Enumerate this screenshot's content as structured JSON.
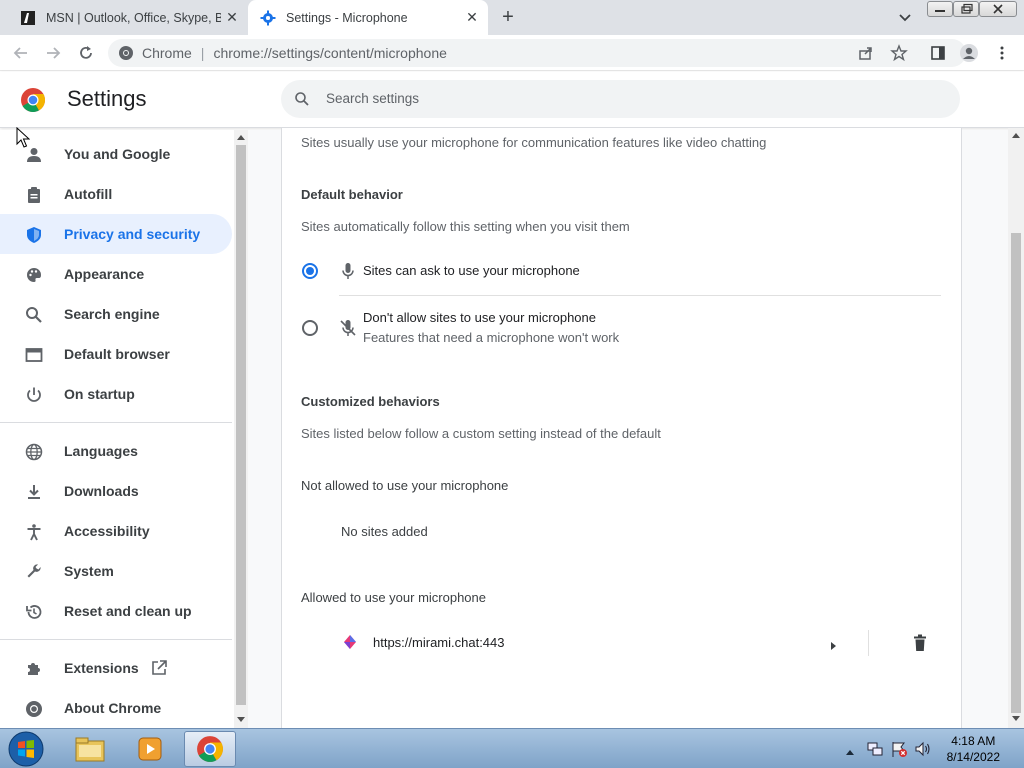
{
  "tabs": [
    {
      "title": "MSN | Outlook, Office, Skype, Bing",
      "close": "✕"
    },
    {
      "title": "Settings - Microphone",
      "close": "✕"
    }
  ],
  "new_tab": "+",
  "omnibox": {
    "chrome_label": "Chrome",
    "separator": "|",
    "url": "chrome://settings/content/microphone"
  },
  "settings": {
    "title": "Settings",
    "search_placeholder": "Search settings"
  },
  "sidebar": {
    "items": [
      {
        "label": "You and Google",
        "icon": "person-icon"
      },
      {
        "label": "Autofill",
        "icon": "clipboard-icon"
      },
      {
        "label": "Privacy and security",
        "icon": "shield-icon",
        "active": true
      },
      {
        "label": "Appearance",
        "icon": "palette-icon"
      },
      {
        "label": "Search engine",
        "icon": "search-icon"
      },
      {
        "label": "Default browser",
        "icon": "browser-icon"
      },
      {
        "label": "On startup",
        "icon": "power-icon"
      },
      {
        "label": "Languages",
        "icon": "globe-icon"
      },
      {
        "label": "Downloads",
        "icon": "download-icon"
      },
      {
        "label": "Accessibility",
        "icon": "accessibility-icon"
      },
      {
        "label": "System",
        "icon": "wrench-icon"
      },
      {
        "label": "Reset and clean up",
        "icon": "history-icon"
      },
      {
        "label": "Extensions",
        "icon": "puzzle-icon"
      },
      {
        "label": "About Chrome",
        "icon": "chrome-icon"
      }
    ]
  },
  "main": {
    "intro": "Sites usually use your microphone for communication features like video chatting",
    "default_behavior": {
      "heading": "Default behavior",
      "subtext": "Sites automatically follow this setting when you visit them",
      "option_allow": "Sites can ask to use your microphone",
      "option_block": "Don't allow sites to use your microphone",
      "option_block_sub": "Features that need a microphone won't work",
      "selected": "allow"
    },
    "custom": {
      "heading": "Customized behaviors",
      "subtext": "Sites listed below follow a custom setting instead of the default",
      "blocked_heading": "Not allowed to use your microphone",
      "blocked_empty": "No sites added",
      "allowed_heading": "Allowed to use your microphone",
      "allowed_sites": [
        "https://mirami.chat:443"
      ]
    }
  },
  "taskbar": {
    "time": "4:18 AM",
    "date": "8/14/2022"
  },
  "colors": {
    "accent": "#1a73e8",
    "active_bg": "#e8f0fe"
  }
}
